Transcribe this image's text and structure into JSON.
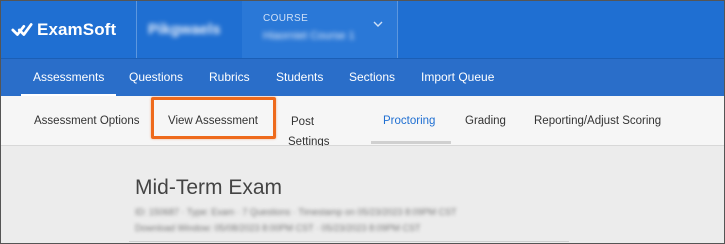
{
  "header": {
    "brand": "ExamSoft",
    "organization": "Pikgwaels",
    "course_label": "COURSE",
    "course_value": "Hiaorniet Course 1",
    "brand_color": "#1f6fd2"
  },
  "main_nav": {
    "items": [
      {
        "label": "Assessments",
        "active": true
      },
      {
        "label": "Questions"
      },
      {
        "label": "Rubrics"
      },
      {
        "label": "Students"
      },
      {
        "label": "Sections"
      },
      {
        "label": "Import Queue"
      }
    ]
  },
  "sub_nav": {
    "items": [
      {
        "label": "Assessment Options"
      },
      {
        "label": "View Assessment",
        "highlighted": true
      },
      {
        "label_line1": "Post",
        "label_line2": "Settings"
      },
      {
        "label": "Proctoring",
        "active": true
      },
      {
        "label": "Grading"
      },
      {
        "label": "Reporting/Adjust Scoring"
      }
    ],
    "highlight_color": "#ee6a1c",
    "active_color": "#1f6fd2"
  },
  "content": {
    "title": "Mid-Term Exam",
    "meta_line1": "ID: 150687 · Type: Exam · 7 Questions · Timestamp on 05/23/2023 8:09PM CST",
    "meta_line2": "Download Window: 05/08/2023 8:00PM CST  ·  05/23/2023 8:09PM CST"
  }
}
